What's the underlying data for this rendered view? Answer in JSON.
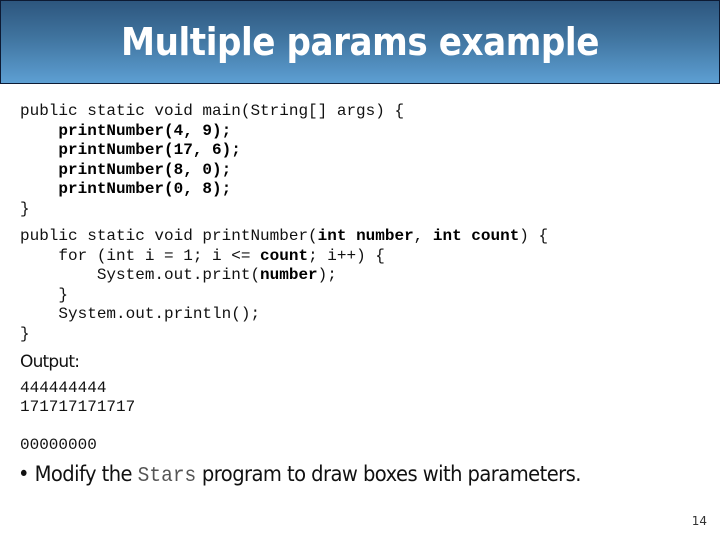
{
  "slide": {
    "title": "Multiple params example",
    "page_number": "14",
    "title_gradient": [
      "#2d567e",
      "#5d9fd3"
    ]
  },
  "code_main": {
    "lines": [
      [
        {
          "t": "public static void main(String[] args) {",
          "b": false
        }
      ],
      [
        {
          "t": "    ",
          "b": false
        },
        {
          "t": "printNumber(4, 9);",
          "b": true
        }
      ],
      [
        {
          "t": "    ",
          "b": false
        },
        {
          "t": "printNumber(17, 6);",
          "b": true
        }
      ],
      [
        {
          "t": "    ",
          "b": false
        },
        {
          "t": "printNumber(8, 0);",
          "b": true
        }
      ],
      [
        {
          "t": "    ",
          "b": false
        },
        {
          "t": "printNumber(0, 8);",
          "b": true
        }
      ],
      [
        {
          "t": "}",
          "b": false
        }
      ]
    ]
  },
  "code_method": {
    "lines": [
      [
        {
          "t": "public static void printNumber(",
          "b": false
        },
        {
          "t": "int number",
          "b": true
        },
        {
          "t": ", ",
          "b": false
        },
        {
          "t": "int count",
          "b": true
        },
        {
          "t": ") {",
          "b": false
        }
      ],
      [
        {
          "t": "    for (int i = 1; i <= ",
          "b": false
        },
        {
          "t": "count",
          "b": true
        },
        {
          "t": "; i++) {",
          "b": false
        }
      ],
      [
        {
          "t": "        System.out.print(",
          "b": false
        },
        {
          "t": "number",
          "b": true
        },
        {
          "t": ");",
          "b": false
        }
      ],
      [
        {
          "t": "    }",
          "b": false
        }
      ],
      [
        {
          "t": "    System.out.println();",
          "b": false
        }
      ],
      [
        {
          "t": "}",
          "b": false
        }
      ]
    ]
  },
  "output": {
    "label": "Output:",
    "lines": [
      "444444444",
      "171717171717",
      "",
      "00000000"
    ]
  },
  "bullet": {
    "marker": "•",
    "text_before": " Modify the ",
    "code_word": "Stars",
    "text_after": " program to draw boxes with parameters."
  }
}
